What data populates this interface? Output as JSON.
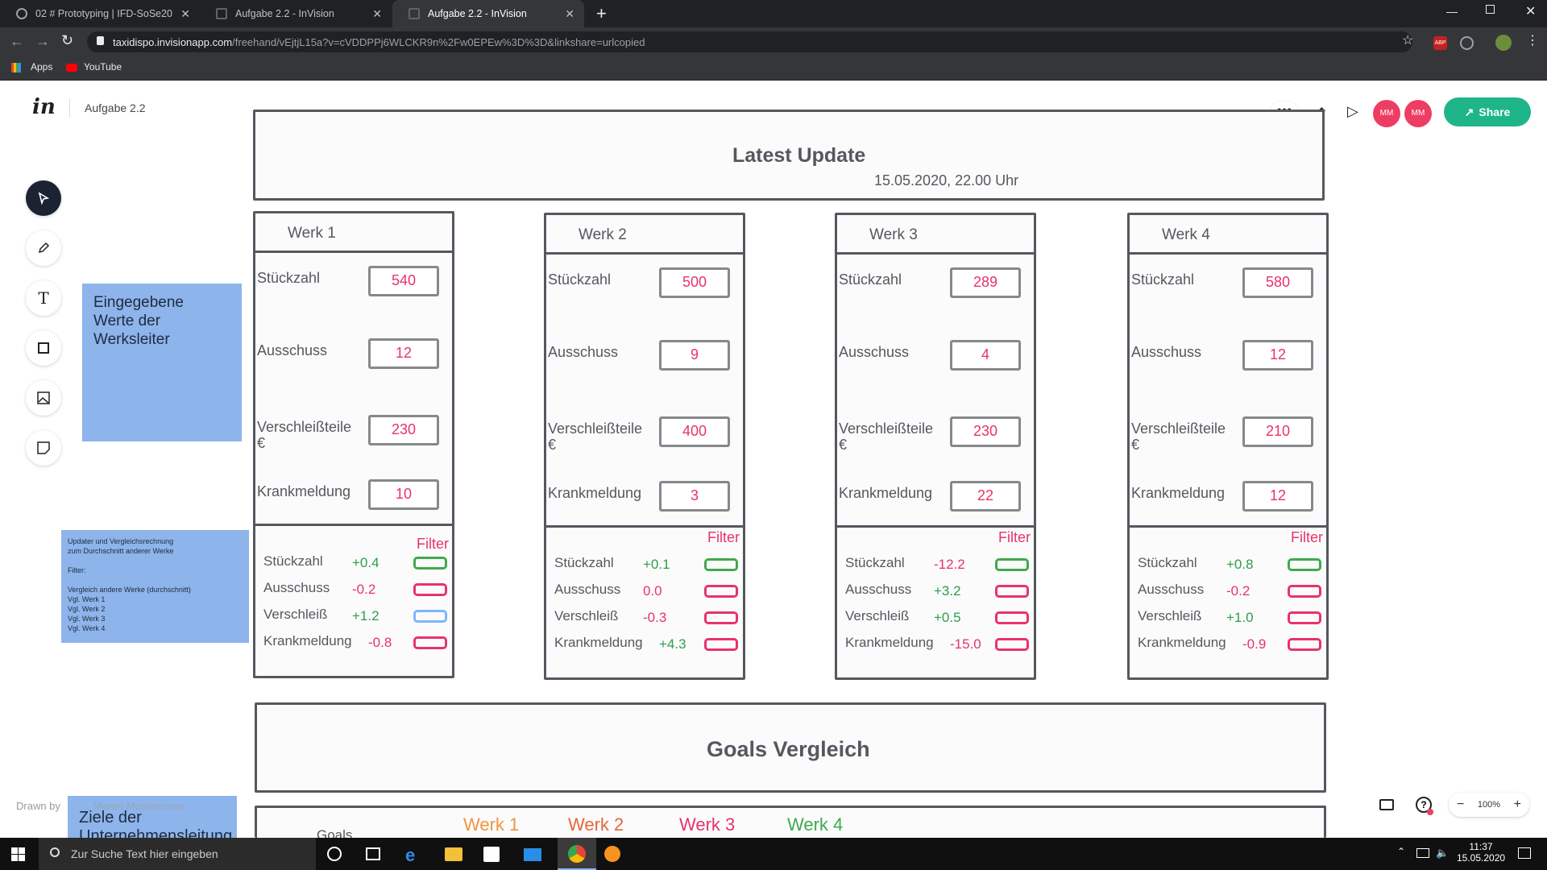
{
  "browser": {
    "tabs": [
      {
        "label": "02 # Prototyping | IFD-SoSe20",
        "active": false
      },
      {
        "label": "Aufgabe 2.2 - InVision",
        "active": false
      },
      {
        "label": "Aufgabe 2.2 - InVision",
        "active": true
      }
    ],
    "url_host": "taxidispo.invisionapp.com",
    "url_path": "/freehand/vEjtjL15a?v=cVDDPPj6WLCKR9n%2Fw0EPEw%3D%3D&linkshare=urlcopied",
    "bookmarks": [
      "Apps",
      "YouTube"
    ]
  },
  "app": {
    "logo": "in",
    "doc_title": "Aufgabe 2.2",
    "avatars": [
      "MM",
      "MM"
    ],
    "share_label": "Share",
    "zoom": "100%",
    "drawn_by": "Drawn by",
    "author": "Maren Mustermann"
  },
  "board": {
    "header_title": "Latest Update",
    "header_date": "15.05.2020, 22.00 Uhr",
    "sticky_input": "Eingegebene\nWerte der\nWerksleiter",
    "sticky_compare": "Updater und Vergleichsrechnung\nzum Durchschnitt anderer Werke\n\nFilter:\n\nVergleich andere Werke (durchschnitt)\nVgl. Werk 1\nVgl. Werk 2\nVgl. Werk 3\nVgl. Werk 4",
    "sticky_goals": "Ziele der\nUnternehmensleitung",
    "field_labels": [
      "Stückzahl",
      "Ausschuss",
      "Verschleißteile\n€",
      "Krankmeldung"
    ],
    "filter_label": "Filter",
    "compare_labels": [
      "Stückzahl",
      "Ausschuss",
      "Verschleiß",
      "Krankmeldung"
    ],
    "werke": [
      {
        "name": "Werk 1",
        "values": [
          "540",
          "12",
          "230",
          "10"
        ],
        "deltas": [
          "+0.4",
          "-0.2",
          "+1.2",
          "-0.8"
        ]
      },
      {
        "name": "Werk 2",
        "values": [
          "500",
          "9",
          "400",
          "3"
        ],
        "deltas": [
          "+0.1",
          "0.0",
          "-0.3",
          "+4.3"
        ]
      },
      {
        "name": "Werk 3",
        "values": [
          "289",
          "4",
          "230",
          "22"
        ],
        "deltas": [
          "-12.2",
          "+3.2",
          "+0.5",
          "-15.0"
        ]
      },
      {
        "name": "Werk 4",
        "values": [
          "580",
          "12",
          "210",
          "12"
        ],
        "deltas": [
          "+0.8",
          "-0.2",
          "+1.0",
          "-0.9"
        ]
      }
    ],
    "goals_title": "Goals Vergleich",
    "goals_row_label": "Goals",
    "goals_werke": [
      "Werk 1",
      "Werk 2",
      "Werk 3",
      "Werk 4"
    ],
    "goals_colors": [
      "#f0963c",
      "#e8663a",
      "#e8336a",
      "#3faa4b"
    ]
  },
  "taskbar": {
    "search_placeholder": "Zur Suche Text hier eingeben",
    "time": "11:37",
    "date": "15.05.2020"
  }
}
